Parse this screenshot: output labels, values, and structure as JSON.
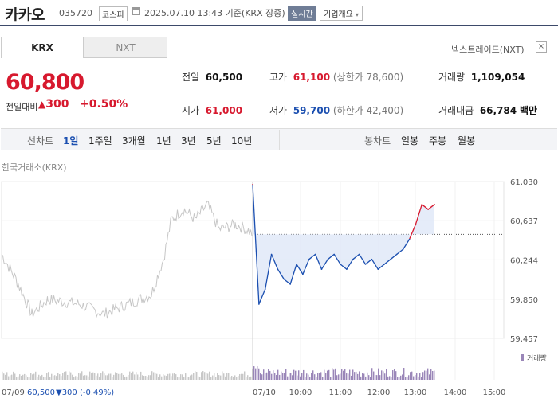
{
  "header": {
    "title": "카카오",
    "code": "035720",
    "market": "코스피",
    "datetime": "2025.07.10 13:43 기준(KRX 장중)",
    "realtime_label": "실시간",
    "company_info_label": "기업개요"
  },
  "exchange_tabs": [
    "KRX",
    "NXT"
  ],
  "nxt_link": "넥스트레이드(NXT)",
  "price": {
    "current": "60,800",
    "diff_label": "전일대비",
    "diff_value": "300",
    "diff_pct": "+0.50%"
  },
  "stats": {
    "prev_close_label": "전일",
    "prev_close": "60,500",
    "high_label": "고가",
    "high": "61,100",
    "upper_limit": "(상한가 78,600)",
    "volume_label": "거래량",
    "volume": "1,109,054",
    "open_label": "시가",
    "open": "61,000",
    "low_label": "저가",
    "low": "59,700",
    "lower_limit": "(하한가 42,400)",
    "amount_label": "거래대금",
    "amount": "66,784",
    "amount_unit": "백만"
  },
  "period_bar": {
    "line_label": "선차트",
    "line_periods": [
      "1일",
      "1주일",
      "3개월",
      "1년",
      "3년",
      "5년",
      "10년"
    ],
    "selected": "1일",
    "candle_label": "봉차트",
    "candle_periods": [
      "일봉",
      "주봉",
      "월봉"
    ]
  },
  "chart_source_label": "한국거래소(KRX)",
  "footer": {
    "prev_date": "07/09",
    "prev_close": "60,500",
    "prev_change": "▼300 (-0.49%)"
  },
  "colors": {
    "up": "#d7192e",
    "down": "#1b4fb0",
    "prev_line": "#c6c6c6",
    "volume_today": "#9a86b8"
  },
  "chart_data": {
    "type": "line",
    "ylim": [
      59457,
      61030
    ],
    "y_ticks": [
      "61,030",
      "60,637",
      "60,244",
      "59,850",
      "59,457"
    ],
    "x_ticks": [
      "07/10",
      "10:00",
      "11:00",
      "12:00",
      "13:00",
      "14:00",
      "15:00"
    ],
    "reference_price": 60500,
    "volume_label": "거래량",
    "series": [
      {
        "x": [
          "09:00",
          "09:10",
          "09:20",
          "09:30",
          "09:40",
          "09:50",
          "10:00",
          "10:10",
          "10:20",
          "10:30",
          "10:40",
          "10:50",
          "11:00",
          "11:10",
          "11:20",
          "11:30",
          "11:40",
          "11:50",
          "12:00",
          "12:10",
          "12:20",
          "12:30",
          "12:40",
          "12:50",
          "13:00",
          "13:10",
          "13:20",
          "13:30",
          "13:40",
          "13:43"
        ],
        "values": [
          61000,
          59800,
          59950,
          60300,
          60150,
          60050,
          60000,
          60200,
          60100,
          60250,
          60300,
          60150,
          60250,
          60300,
          60200,
          60150,
          60250,
          60300,
          60200,
          60250,
          60150,
          60200,
          60250,
          60300,
          60350,
          60450,
          60600,
          60800,
          60750,
          60800
        ]
      }
    ]
  }
}
